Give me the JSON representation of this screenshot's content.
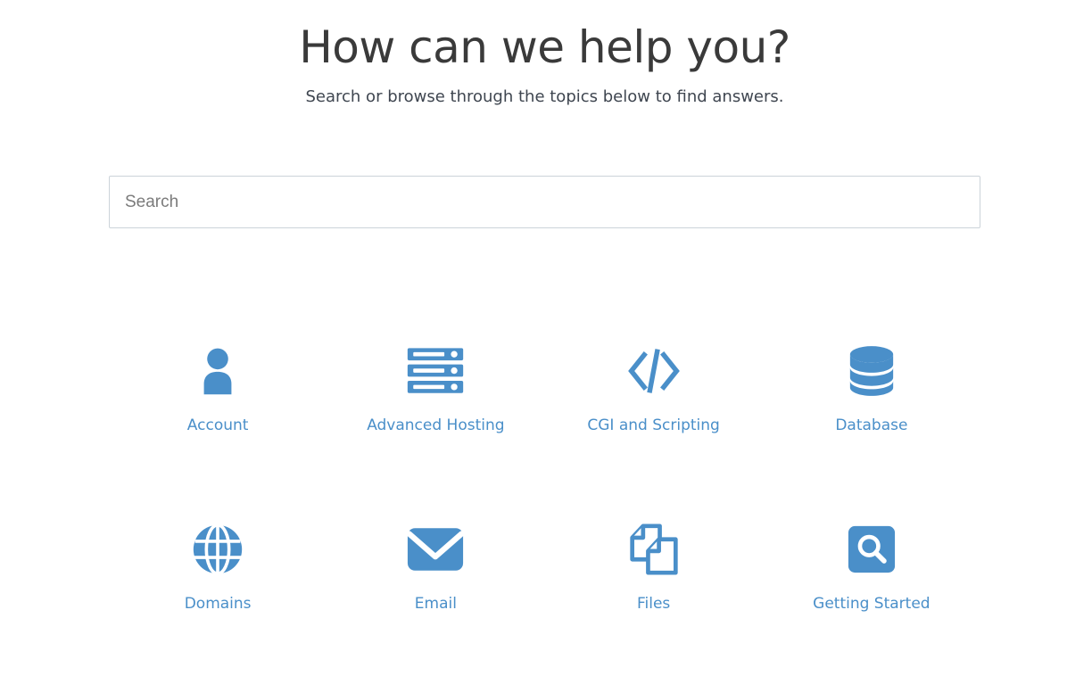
{
  "header": {
    "title": "How can we help you?",
    "subtitle": "Search or browse through the topics below to find answers."
  },
  "search": {
    "placeholder": "Search",
    "value": ""
  },
  "colors": {
    "icon_blue": "#4a8fc9",
    "link_blue": "#4a8fc9",
    "heading": "#3a3a3a",
    "subtitle": "#3f4650",
    "input_border": "#ccd3d9",
    "placeholder": "#7b7b7b",
    "background": "#ffffff"
  },
  "topics": [
    {
      "label": "Account",
      "icon": "user-icon"
    },
    {
      "label": "Advanced Hosting",
      "icon": "server-rack-icon"
    },
    {
      "label": "CGI and Scripting",
      "icon": "code-brackets-icon"
    },
    {
      "label": "Database",
      "icon": "database-cylinder-icon"
    },
    {
      "label": "Domains",
      "icon": "globe-icon"
    },
    {
      "label": "Email",
      "icon": "envelope-icon"
    },
    {
      "label": "Files",
      "icon": "documents-copy-icon"
    },
    {
      "label": "Getting Started",
      "icon": "magnifier-square-icon"
    }
  ]
}
